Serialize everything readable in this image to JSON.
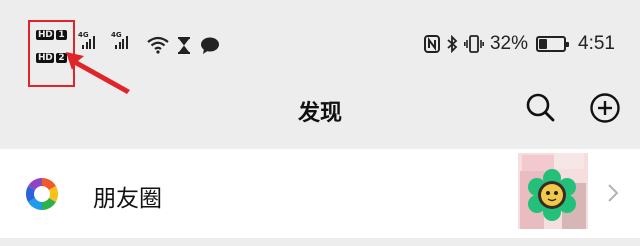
{
  "status_bar": {
    "sim_badges": [
      {
        "hd": "HD",
        "slot": "1"
      },
      {
        "hd": "HD",
        "slot": "2"
      }
    ],
    "network_labels": [
      "4G",
      "4G"
    ],
    "battery_percent": "32%",
    "battery_level": 0.32,
    "time": "4:51",
    "icons": [
      "wifi-icon",
      "hourglass-icon",
      "chat-bubble-icon",
      "nfc-icon",
      "bluetooth-icon",
      "vibrate-icon",
      "battery-icon"
    ]
  },
  "annotation": {
    "box_color": "#e0242a",
    "arrow_color": "#e0242a"
  },
  "nav": {
    "title": "发现",
    "icons": [
      "search-icon",
      "add-circle-icon"
    ]
  },
  "list": {
    "items": [
      {
        "label": "朋友圈",
        "icon": "moments-aperture-icon",
        "trailing": "chevron-right-icon"
      }
    ]
  },
  "colors": {
    "background": "#ededed",
    "card": "#ffffff",
    "highlight": "#e0242a"
  }
}
